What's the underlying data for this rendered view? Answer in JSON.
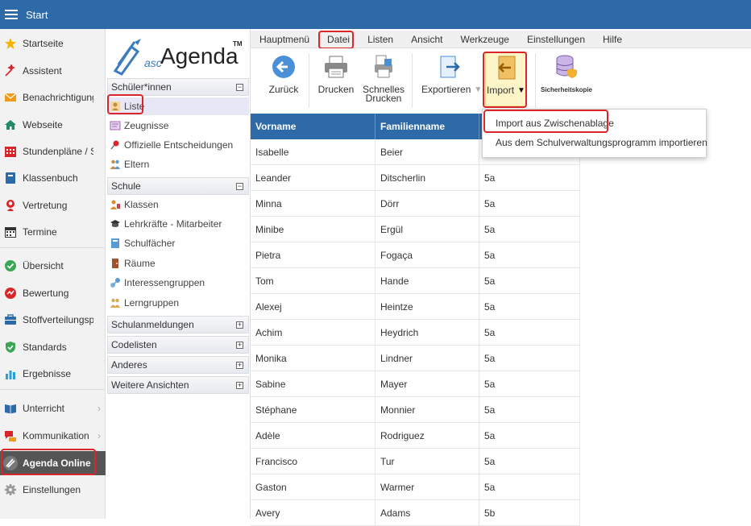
{
  "topbar": {
    "title": "Start"
  },
  "leftnav": {
    "items": [
      {
        "label": "Startseite",
        "icon": "star-icon"
      },
      {
        "label": "Assistent",
        "icon": "assistant-icon"
      },
      {
        "label": "Benachrichtigungen",
        "icon": "envelope-icon"
      },
      {
        "label": "Webseite",
        "icon": "house-icon"
      },
      {
        "label": "Stundenpläne / Supplierpläne",
        "icon": "calendar-grid-icon"
      },
      {
        "label": "Klassenbuch",
        "icon": "book-icon"
      },
      {
        "label": "Vertretung",
        "icon": "person-icon"
      },
      {
        "label": "Termine",
        "icon": "calendar-icon"
      },
      {
        "label": "Übersicht",
        "icon": "check-circle-icon"
      },
      {
        "label": "Bewertung",
        "icon": "grade-icon"
      },
      {
        "label": "Stoffverteilungsplan",
        "icon": "briefcase-icon"
      },
      {
        "label": "Standards",
        "icon": "shield-check-icon"
      },
      {
        "label": "Ergebnisse",
        "icon": "bar-chart-icon"
      },
      {
        "label": "Unterricht",
        "icon": "book-open-icon"
      },
      {
        "label": "Kommunikation",
        "icon": "chat-icon"
      },
      {
        "label": "Agenda Online",
        "icon": "agenda-logo-icon"
      },
      {
        "label": "Einstellungen",
        "icon": "gear-icon"
      }
    ]
  },
  "logo": {
    "prefix": "asc",
    "name": "Agenda",
    "tm": "TM"
  },
  "secondnav": {
    "sections": [
      "Schüler*innen",
      "Schule",
      "Schulanmeldungen",
      "Codelisten",
      "Anderes",
      "Weitere Ansichten"
    ],
    "collapse": "−",
    "expand": "+",
    "schueler": [
      "Liste",
      "Zeugnisse",
      "Offizielle Entscheidungen",
      "Eltern"
    ],
    "schule": [
      "Klassen",
      "Lehrkräfte - Mitarbeiter",
      "Schulfächer",
      "Räume",
      "Interessengruppen",
      "Lerngruppen"
    ]
  },
  "menubar": [
    "Hauptmenü",
    "Datei",
    "Listen",
    "Ansicht",
    "Werkzeuge",
    "Einstellungen",
    "Hilfe"
  ],
  "toolbar": {
    "zurueck": "Zurück",
    "drucken": "Drucken",
    "schnelles1": "Schnelles",
    "schnelles2": "Drucken",
    "exportieren": "Exportieren",
    "import": "Import",
    "backup": "Sicherheitskopie"
  },
  "dropdown": [
    "Import aus Zwischenablage",
    "Aus dem Schulverwaltungsprogramm importieren"
  ],
  "table": {
    "headers": [
      "Vorname",
      "Familienname"
    ],
    "rows": [
      [
        "Isabelle",
        "Beier",
        ""
      ],
      [
        "Leander",
        "Ditscherlin",
        "5a"
      ],
      [
        "Minna",
        "Dörr",
        "5a"
      ],
      [
        "Minibe",
        "Ergül",
        "5a"
      ],
      [
        "Pietra",
        "Fogaça",
        "5a"
      ],
      [
        "Tom",
        "Hande",
        "5a"
      ],
      [
        "Alexej",
        "Heintze",
        "5a"
      ],
      [
        "Achim",
        "Heydrich",
        "5a"
      ],
      [
        "Monika",
        "Lindner",
        "5a"
      ],
      [
        "Sabine",
        "Mayer",
        "5a"
      ],
      [
        "Stéphane",
        "Monnier",
        "5a"
      ],
      [
        "Adèle",
        "Rodriguez",
        "5a"
      ],
      [
        "Francisco",
        "Tur",
        "5a"
      ],
      [
        "Gaston",
        "Warmer",
        "5a"
      ],
      [
        "Avery",
        "Adams",
        "5b"
      ]
    ]
  },
  "colors": {
    "accent": "#2e6aa8",
    "highlight": "#d9262b",
    "menuDark": "#555555"
  }
}
